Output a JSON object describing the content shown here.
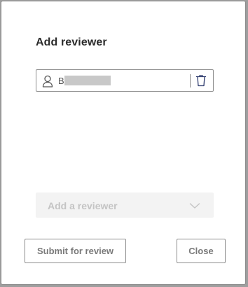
{
  "dialog": {
    "title": "Add reviewer"
  },
  "reviewer": {
    "name_initial": "B",
    "name_redacted": true,
    "icon": "person-icon",
    "remove_icon": "trash-icon"
  },
  "add_reviewer_select": {
    "placeholder": "Add a reviewer",
    "disabled": true,
    "icon": "chevron-down-icon"
  },
  "buttons": {
    "submit_label": "Submit for review",
    "close_label": "Close"
  },
  "colors": {
    "icon_accent": "#2e3b6e",
    "text_dark": "#2b2b2b",
    "text_muted": "#7a7a7a",
    "disabled_text": "#c4c4c4",
    "disabled_bg": "#f3f3f3",
    "border": "#8d8d8d"
  }
}
